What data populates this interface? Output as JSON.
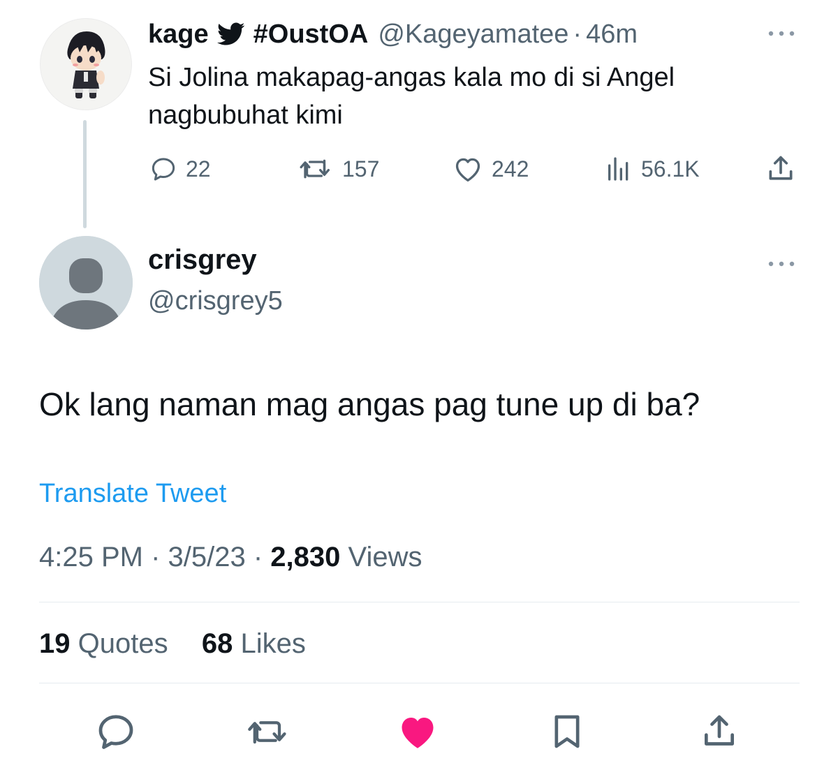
{
  "parent_tweet": {
    "display_name": "kage",
    "name_hashtag": "#OustOA",
    "handle": "@Kageyamatee",
    "separator": "·",
    "time": "46m",
    "text": "Si Jolina makapag-angas kala mo di si Angel nagbubuhat kimi",
    "actions": {
      "replies": "22",
      "retweets": "157",
      "likes": "242",
      "views": "56.1K"
    }
  },
  "main_tweet": {
    "display_name": "crisgrey",
    "handle": "@crisgrey5",
    "text": "Ok lang naman mag angas pag tune up di ba?",
    "translate_label": "Translate Tweet",
    "meta": {
      "time": "4:25 PM",
      "sep1": " · ",
      "date": "3/5/23",
      "sep2": " · ",
      "views_count": "2,830",
      "views_label": " Views"
    },
    "stats": {
      "quotes_count": "19",
      "quotes_label": " Quotes",
      "likes_count": "68",
      "likes_label": " Likes"
    }
  },
  "colors": {
    "text_primary": "#0f1419",
    "text_secondary": "#536471",
    "link": "#1d9bf0",
    "like_active": "#f91880",
    "divider": "#e6ecf0",
    "thread_line": "#cfd9de"
  },
  "icons": {
    "bird": "twitter-bird-icon",
    "more": "more-dots-icon",
    "reply": "reply-bubble-icon",
    "retweet": "retweet-icon",
    "like": "heart-icon",
    "views": "views-bar-chart-icon",
    "share": "share-upload-icon",
    "bookmark": "bookmark-icon"
  }
}
